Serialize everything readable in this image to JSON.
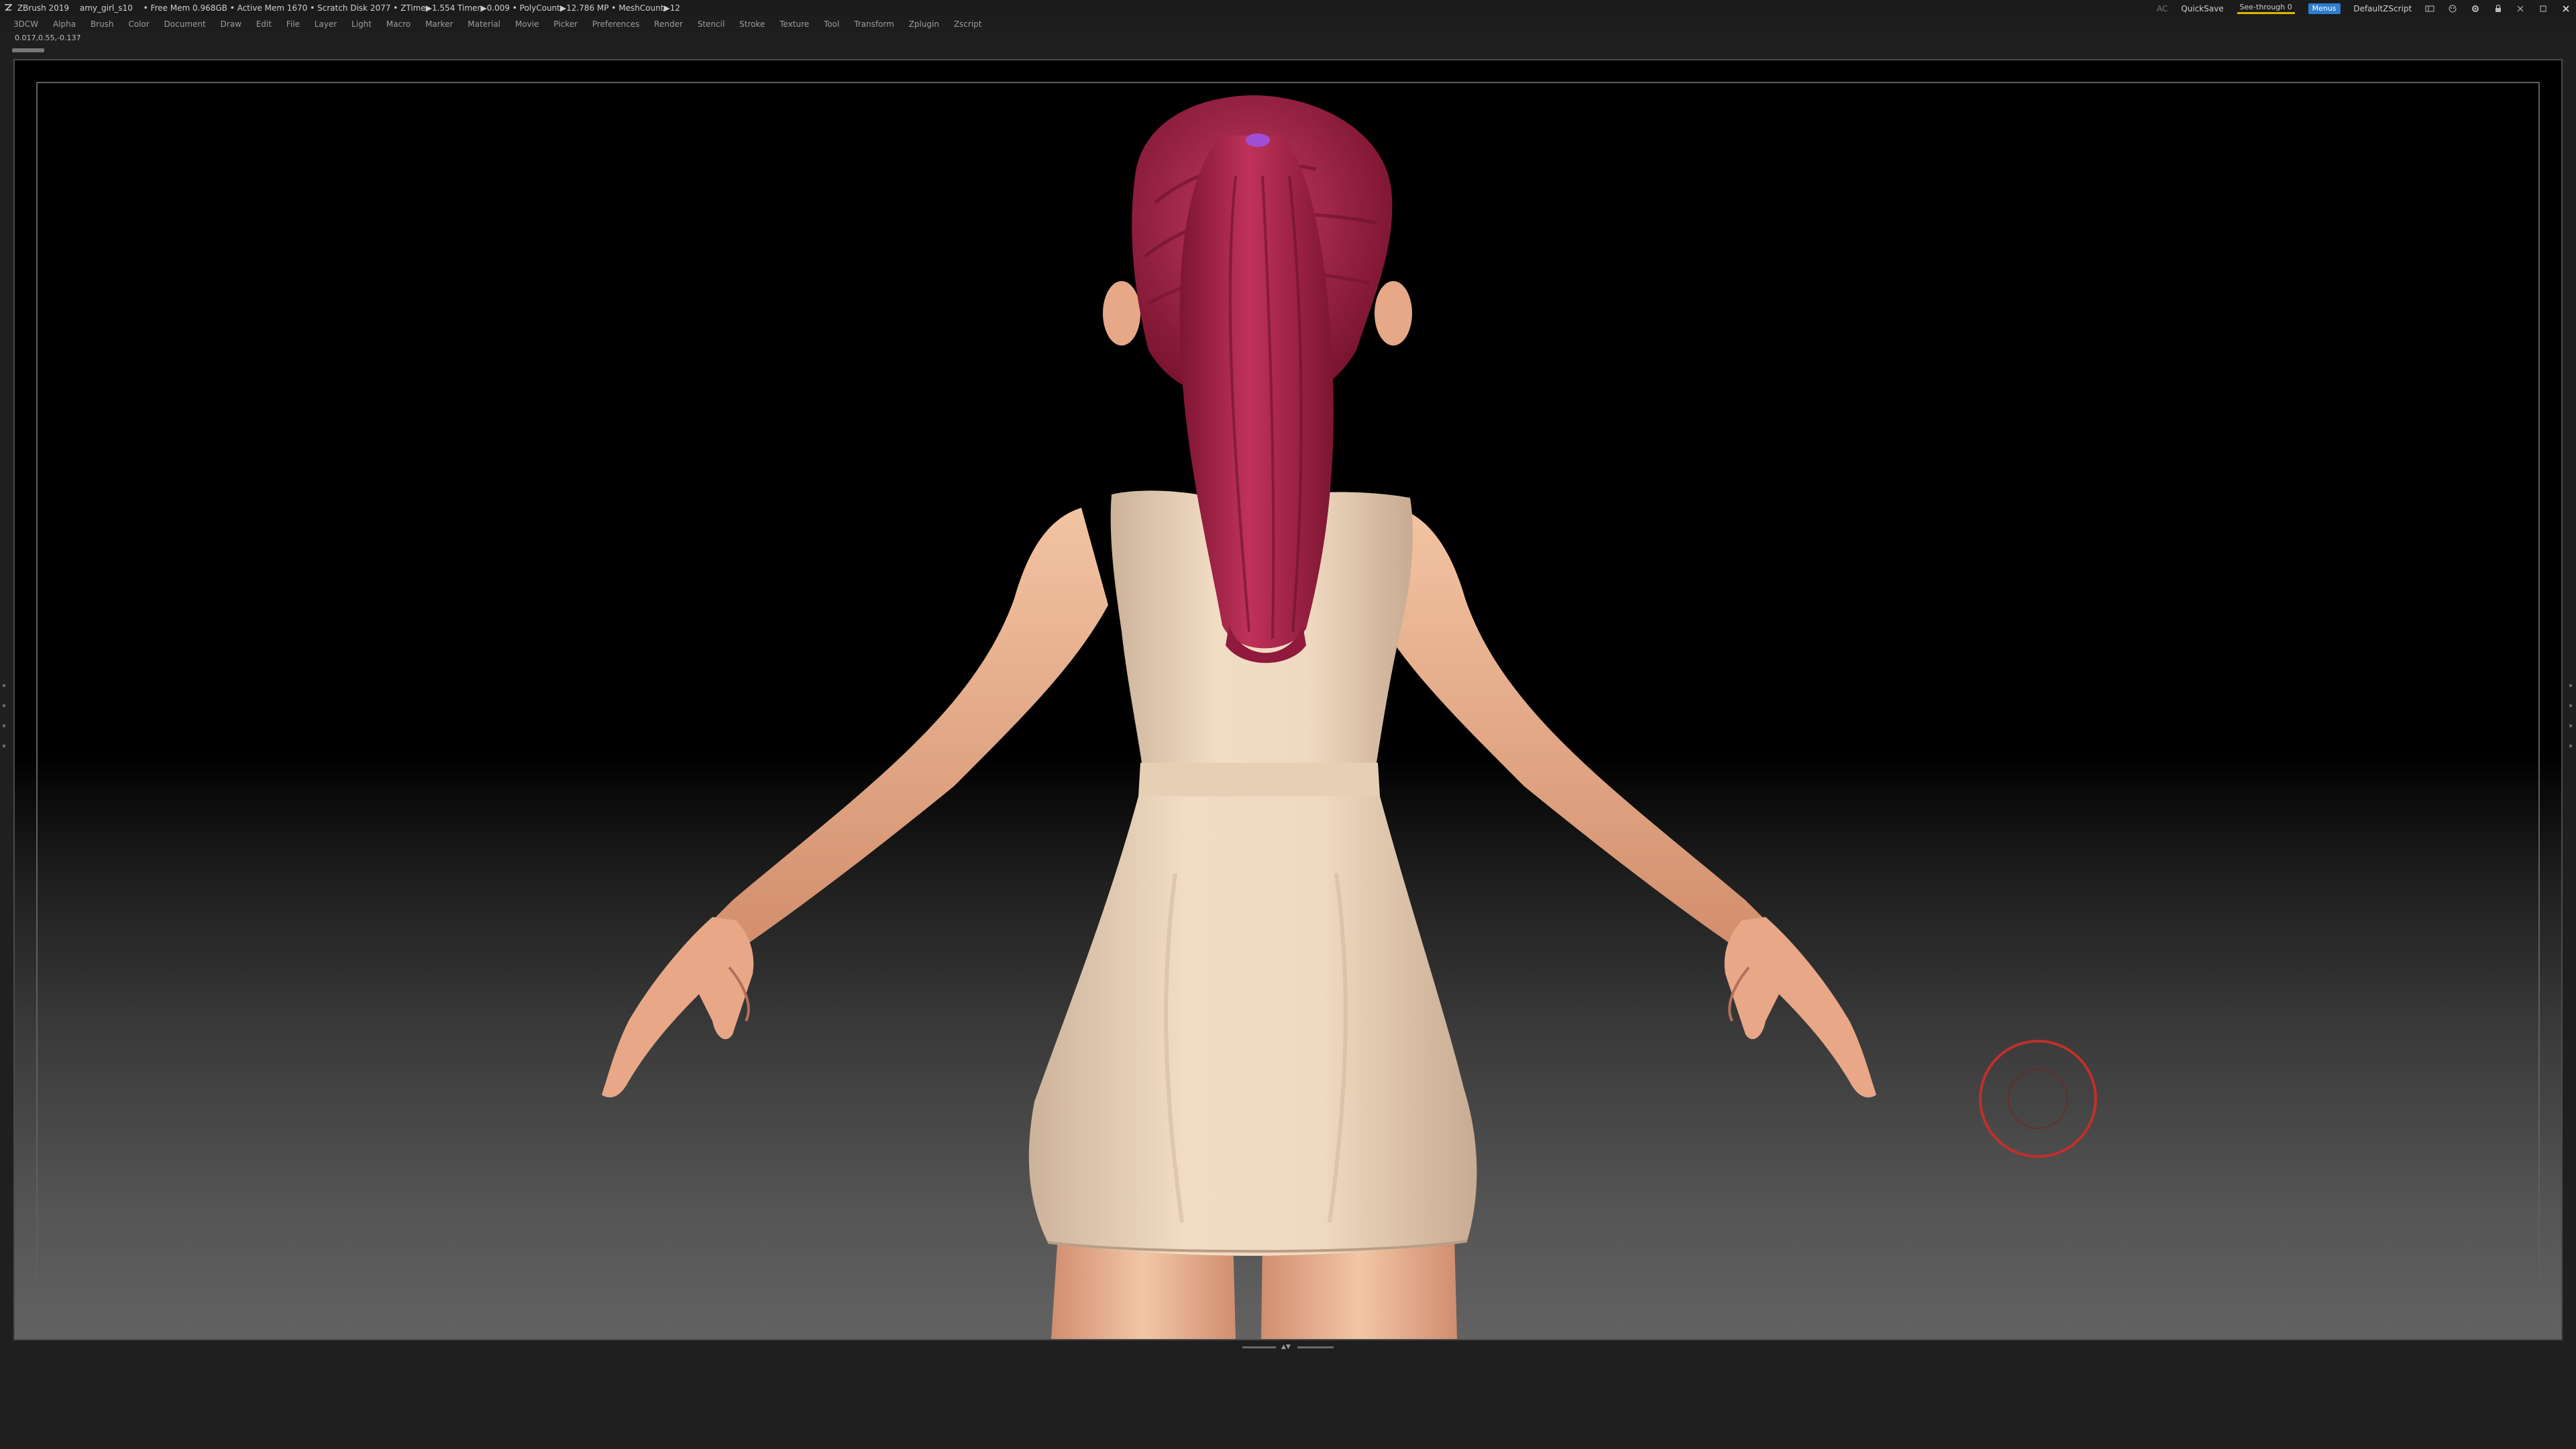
{
  "titlebar": {
    "app": "ZBrush 2019",
    "file": "amy_girl_s10",
    "stats": "• Free Mem 0.968GB • Active Mem 1670 • Scratch Disk 2077 • ZTime▶1.554 Timer▶0.009 • PolyCount▶12.786 MP • MeshCount▶12",
    "ac": "AC",
    "quicksave": "QuickSave",
    "seethrough": "See-through   0",
    "menus": "Menus",
    "defaultzscript": "DefaultZScript",
    "accent_color": "#e3b400"
  },
  "menubar": {
    "items": [
      "3DCW",
      "Alpha",
      "Brush",
      "Color",
      "Document",
      "Draw",
      "Edit",
      "File",
      "Layer",
      "Light",
      "Macro",
      "Marker",
      "Material",
      "Movie",
      "Picker",
      "Preferences",
      "Render",
      "Stencil",
      "Stroke",
      "Texture",
      "Tool",
      "Transform",
      "Zplugin",
      "Zscript"
    ]
  },
  "viewport": {
    "coordinates": "0.017,0.55,-0.137",
    "model": {
      "hair_color": "#b1264f",
      "skin_color": "#f2bf9b",
      "dress_color": "#ead3b9",
      "hair_tie_color": "#a04fd6"
    },
    "cursor_icon": "draw-size-circle-icon",
    "cursor_color": "#c0302a"
  }
}
